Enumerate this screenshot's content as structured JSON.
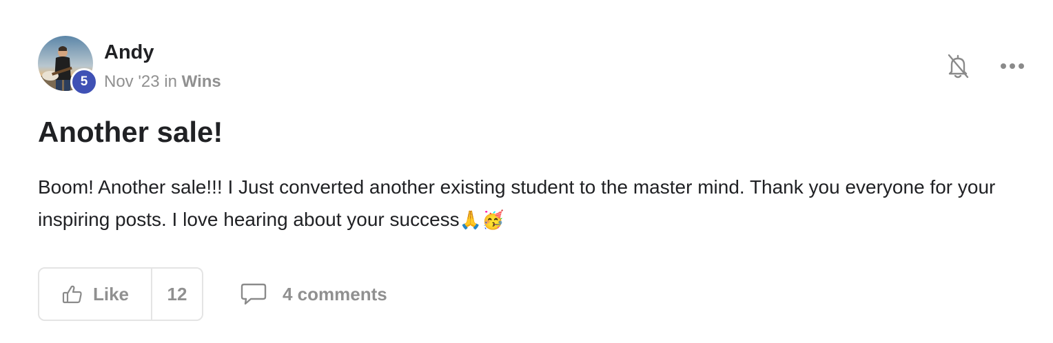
{
  "author": {
    "name": "Andy",
    "level": "5",
    "avatar_icon": "person-with-guitar-photo"
  },
  "meta": {
    "date": "Nov '23",
    "in_label": "in",
    "category": "Wins"
  },
  "post": {
    "title": "Another sale!",
    "body": "Boom! Another sale!!! I Just converted another existing student to the master mind. Thank you everyone for your inspiring posts. I love hearing about your success",
    "emojis": [
      "🙏",
      "🥳"
    ]
  },
  "actions": {
    "like_label": "Like",
    "like_count": "12",
    "comments_label": "4 comments",
    "notification_icon": "bell-off-icon",
    "more_icon": "more-horizontal-icon"
  },
  "colors": {
    "badge": "#3f51b5",
    "muted": "#909090",
    "text": "#202124",
    "border": "#e4e4e4"
  }
}
